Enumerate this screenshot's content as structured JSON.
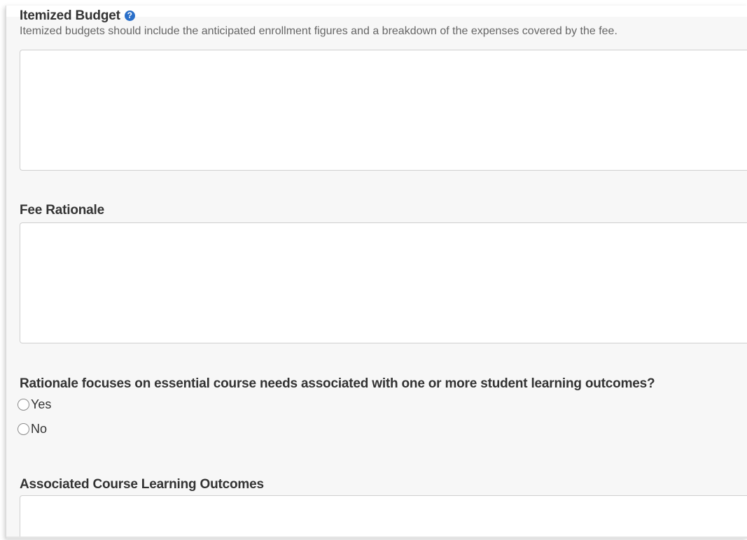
{
  "budget": {
    "label": "Itemized Budget",
    "help_icon": "question-circle-icon",
    "help_text": "Itemized budgets should include the anticipated enrollment figures and a breakdown of the expenses covered by the fee.",
    "value": ""
  },
  "fee_rationale": {
    "label": "Fee Rationale",
    "value": ""
  },
  "rationale_question": {
    "label": "Rationale focuses on essential course needs associated with one or more student learning outcomes?",
    "options": [
      "Yes",
      "No"
    ],
    "selected": null
  },
  "outcomes": {
    "label": "Associated Course Learning Outcomes",
    "value": ""
  },
  "colors": {
    "background": "#f7f7f7",
    "field": "#ffffff",
    "border": "#cfcfcf",
    "accent": "#2a6fc9",
    "text": "#333333",
    "help_text": "#666666"
  }
}
